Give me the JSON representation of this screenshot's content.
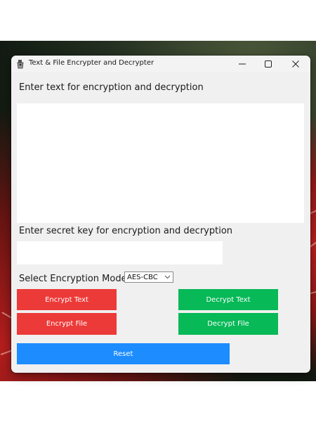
{
  "window": {
    "title": "Text & File Encrypter and Decrypter",
    "controls": [
      "minimize-icon",
      "maximize-icon",
      "close-icon"
    ]
  },
  "labels": {
    "text_prompt": "Enter text for encryption and decryption",
    "key_prompt": "Enter secret key for encryption and decryption",
    "mode_prompt": "Select Encryption Mode:"
  },
  "fields": {
    "text_value": "",
    "key_value": ""
  },
  "mode_select": {
    "selected": "AES-CBC"
  },
  "buttons": {
    "encrypt_text": "Encrypt Text",
    "decrypt_text": "Decrypt Text",
    "encrypt_file": "Encrypt File",
    "decrypt_file": "Decrypt File",
    "reset": "Reset"
  },
  "colors": {
    "encrypt": "#ec3a38",
    "decrypt": "#07b957",
    "reset": "#1d8cff",
    "window_bg": "#f0f0f0"
  }
}
